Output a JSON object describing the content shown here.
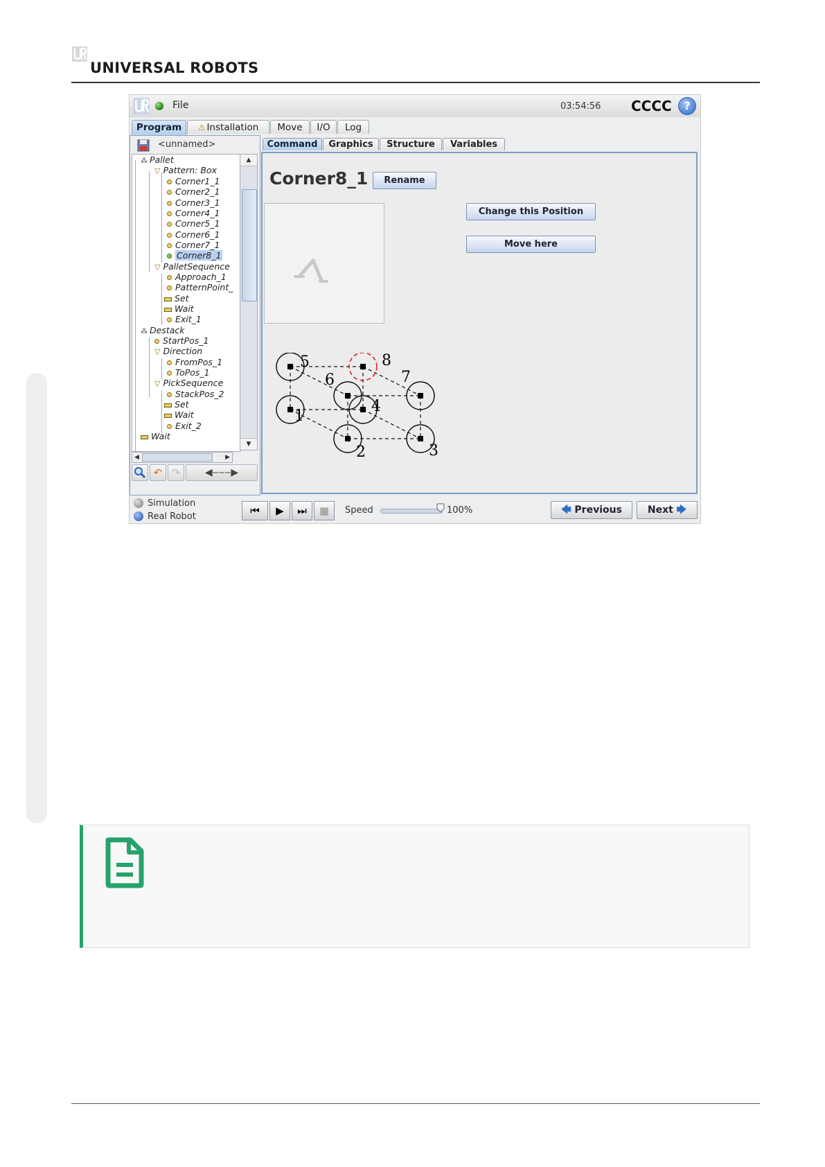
{
  "page": {
    "brand": "UNIVERSAL ROBOTS"
  },
  "app": {
    "menu": {
      "file": "File"
    },
    "clock": "03:54:56",
    "robot_name": "CCCC",
    "help": "?",
    "main_tabs": [
      {
        "label": "Program",
        "active": true
      },
      {
        "label": "Installation",
        "warning": true
      },
      {
        "label": "Move"
      },
      {
        "label": "I/O"
      },
      {
        "label": "Log"
      }
    ],
    "program_name": "<unnamed>",
    "tree": [
      {
        "label": "Pallet",
        "icon": "pallet-icon",
        "depth": 0
      },
      {
        "label": "Pattern: Box",
        "icon": "triangle-icon",
        "depth": 1
      },
      {
        "label": "Corner1_1",
        "icon": "waypoint-icon",
        "depth": 2
      },
      {
        "label": "Corner2_1",
        "icon": "waypoint-icon",
        "depth": 2
      },
      {
        "label": "Corner3_1",
        "icon": "waypoint-icon",
        "depth": 2
      },
      {
        "label": "Corner4_1",
        "icon": "waypoint-icon",
        "depth": 2
      },
      {
        "label": "Corner5_1",
        "icon": "waypoint-icon",
        "depth": 2
      },
      {
        "label": "Corner6_1",
        "icon": "waypoint-icon",
        "depth": 2
      },
      {
        "label": "Corner7_1",
        "icon": "waypoint-icon",
        "depth": 2
      },
      {
        "label": "Corner8_1",
        "icon": "waypoint-icon",
        "depth": 2,
        "selected": true
      },
      {
        "label": "PalletSequence",
        "icon": "triangle-icon",
        "depth": 1
      },
      {
        "label": "Approach_1",
        "icon": "waypoint-icon",
        "depth": 2
      },
      {
        "label": "PatternPoint_",
        "icon": "waypoint-icon",
        "depth": 2
      },
      {
        "label": "Set",
        "icon": "set-icon",
        "depth": 2
      },
      {
        "label": "Wait",
        "icon": "wait-icon",
        "depth": 2
      },
      {
        "label": "Exit_1",
        "icon": "waypoint-icon",
        "depth": 2
      },
      {
        "label": "Destack",
        "icon": "pallet-icon",
        "depth": 0
      },
      {
        "label": "StartPos_1",
        "icon": "waypoint-icon",
        "depth": 1
      },
      {
        "label": "Direction",
        "icon": "triangle-icon",
        "depth": 1
      },
      {
        "label": "FromPos_1",
        "icon": "waypoint-icon",
        "depth": 2
      },
      {
        "label": "ToPos_1",
        "icon": "waypoint-icon",
        "depth": 2
      },
      {
        "label": "PickSequence",
        "icon": "triangle-icon",
        "depth": 1
      },
      {
        "label": "StackPos_2",
        "icon": "waypoint-icon",
        "depth": 2
      },
      {
        "label": "Set",
        "icon": "set-icon",
        "depth": 2
      },
      {
        "label": "Wait",
        "icon": "wait-icon",
        "depth": 2
      },
      {
        "label": "Exit_2",
        "icon": "waypoint-icon",
        "depth": 2
      },
      {
        "label": "Wait",
        "icon": "wait-icon",
        "depth": 0
      }
    ],
    "sub_tabs": [
      {
        "label": "Command",
        "active": true
      },
      {
        "label": "Graphics"
      },
      {
        "label": "Structure"
      },
      {
        "label": "Variables"
      }
    ],
    "node_title": "Corner8_1",
    "rename_button": "Rename",
    "change_position_button": "Change this Position",
    "move_here_button": "Move here",
    "diagram": {
      "labels": [
        "1",
        "2",
        "3",
        "4",
        "5",
        "6",
        "7",
        "8"
      ],
      "highlight": "8",
      "highlight_color": "#e02020"
    },
    "modes": {
      "simulation": "Simulation",
      "real_robot": "Real Robot"
    },
    "speed_label": "Speed",
    "speed_value": "100%",
    "speed_fraction": 1.0,
    "previous_button": "Previous",
    "next_button": "Next"
  },
  "note": {
    "accent_color": "#25a36a",
    "icon": "note-document-icon"
  }
}
